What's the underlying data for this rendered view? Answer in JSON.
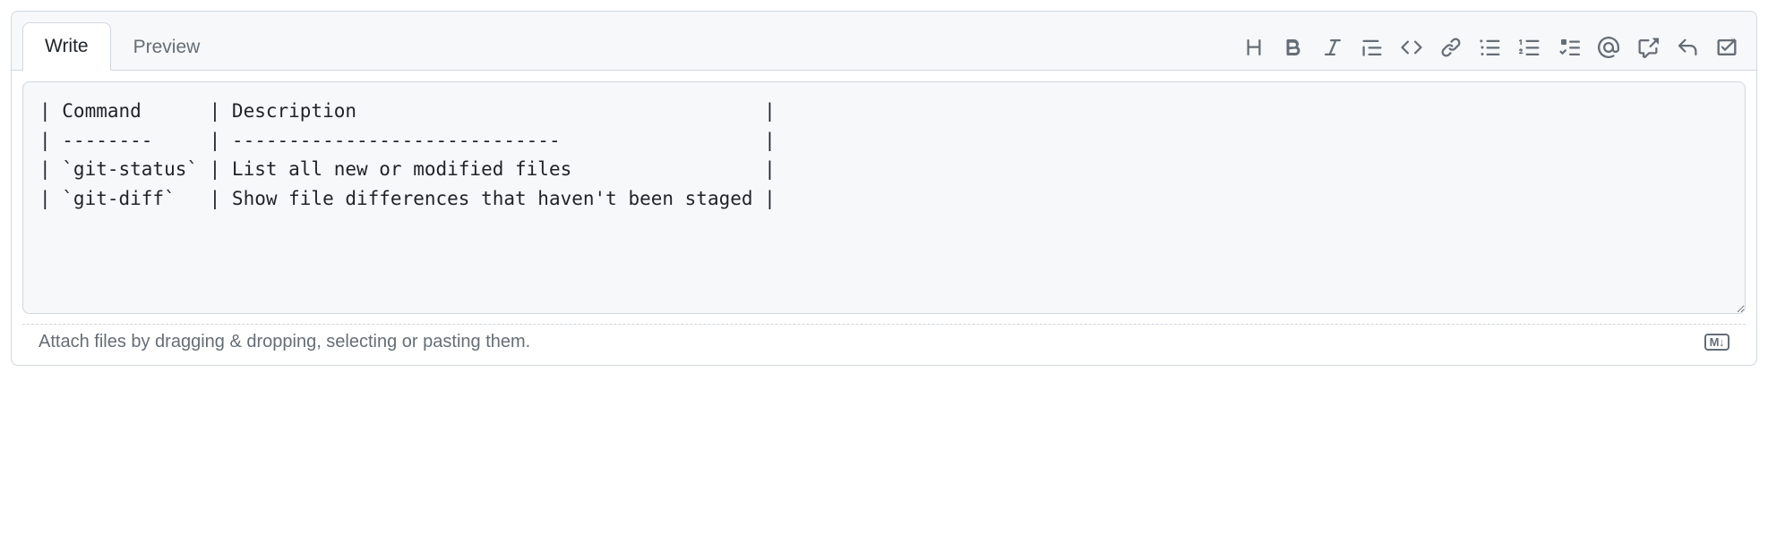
{
  "tabs": {
    "write": "Write",
    "preview": "Preview"
  },
  "editor": {
    "value": "| Command      | Description                                    |\n| --------     | -----------------------------                  |\n| `git-status` | List all new or modified files                 |\n| `git-diff`   | Show file differences that haven't been staged |"
  },
  "footer": {
    "attach_hint": "Attach files by dragging & dropping, selecting or pasting them.",
    "markdown_badge": "M↓"
  },
  "toolbar_icons": [
    "heading",
    "bold",
    "italic",
    "quote",
    "code",
    "link",
    "unordered-list",
    "ordered-list",
    "task-list",
    "mention",
    "cross-reference",
    "reply",
    "suggestion"
  ]
}
